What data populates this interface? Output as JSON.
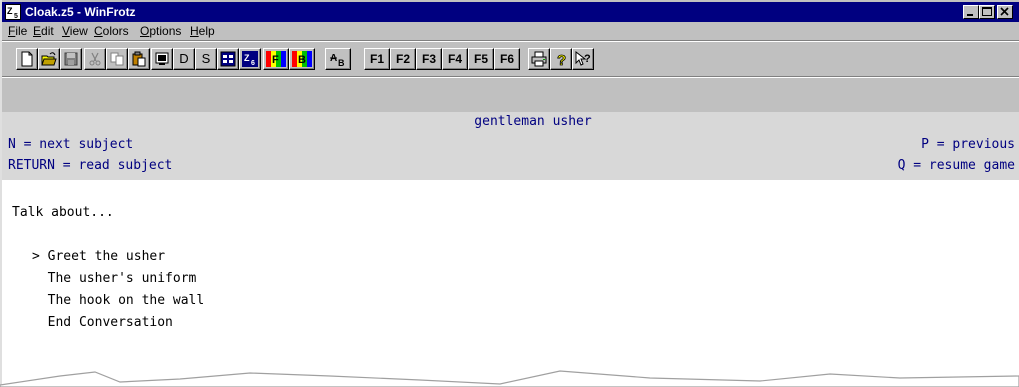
{
  "window": {
    "title": "Cloak.z5 - WinFrotz",
    "app_icon_text": "Z5"
  },
  "menu": [
    {
      "accel": "F",
      "rest": "ile"
    },
    {
      "accel": "E",
      "rest": "dit"
    },
    {
      "accel": "V",
      "rest": "iew"
    },
    {
      "accel": "C",
      "rest": "olors"
    },
    {
      "accel": "O",
      "rest": "ptions"
    },
    {
      "accel": "H",
      "rest": "elp"
    }
  ],
  "toolbar": {
    "d_label": "D",
    "s_label": "S",
    "f_keys": [
      "F1",
      "F2",
      "F3",
      "F4",
      "F5",
      "F6"
    ]
  },
  "status": {
    "title": "gentleman usher",
    "left1": "N = next subject",
    "left2": "RETURN = read subject",
    "right1": "P = previous",
    "right2": "Q = resume game"
  },
  "story": {
    "prompt": "Talk about...",
    "options": [
      "> Greet the usher",
      "  The usher's uniform",
      "  The hook on the wall",
      "  End Conversation"
    ]
  },
  "colors": {
    "title_bar": "#000080",
    "status_text": "#000080",
    "status_bg": "#d8d8d8",
    "chrome": "#c0c0c0"
  }
}
